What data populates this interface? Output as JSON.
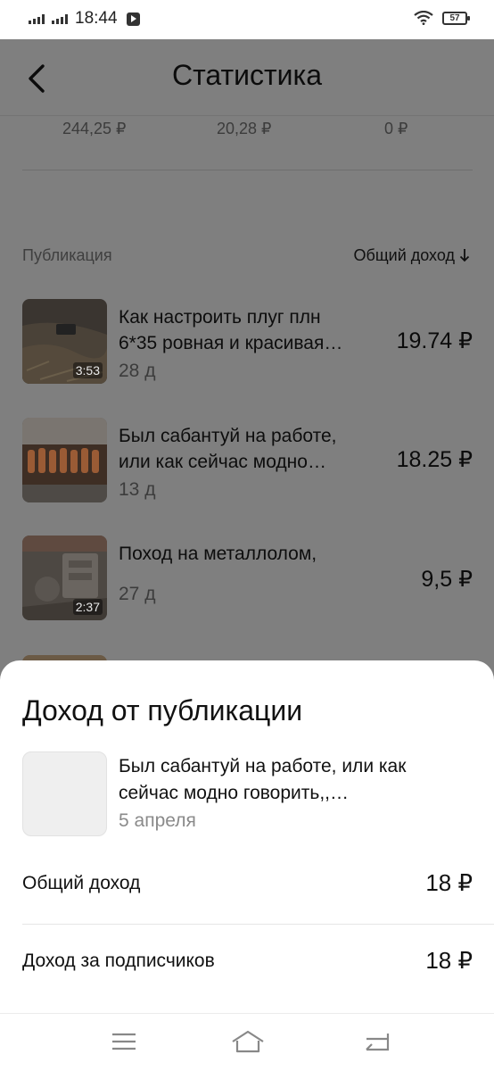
{
  "status_bar": {
    "time": "18:44",
    "battery": "57",
    "icons": [
      "signal-icon",
      "signal-icon",
      "play-icon",
      "wifi-icon",
      "battery-icon"
    ]
  },
  "header": {
    "title": "Статистика",
    "back_icon": "chevron-left-icon"
  },
  "stats": [
    "244,25 ₽",
    "20,28 ₽",
    "0 ₽"
  ],
  "list": {
    "col_left": "Публикация",
    "col_right": "Общий доход",
    "sort_icon": "arrow-down-icon",
    "items": [
      {
        "title_line1": "Как настроить плуг плн",
        "title_line2": "6*35 ровная и красивая…",
        "date": "28 д",
        "amount": "19.74 ₽",
        "duration": "3:53"
      },
      {
        "title_line1": "Был сабантуй на работе,",
        "title_line2": "или как сейчас модно…",
        "date": "13 д",
        "amount": "18.25 ₽",
        "duration": ""
      },
      {
        "title_line1": "Поход на металлолом,",
        "title_line2": "",
        "date": "27 д",
        "amount": "9,5 ₽",
        "duration": "2:37"
      }
    ]
  },
  "sheet": {
    "title": "Доход от публикации",
    "pub_title_line1": "Был сабантуй на работе, или как",
    "pub_title_line2": "сейчас модно говорить,,…",
    "pub_date": "5 апреля",
    "rows": [
      {
        "label": "Общий доход",
        "value": "18 ₽"
      },
      {
        "label": "Доход за подписчиков",
        "value": "18 ₽"
      }
    ]
  },
  "navbar": {
    "icons": [
      "menu-icon",
      "home-icon",
      "back-icon"
    ]
  }
}
